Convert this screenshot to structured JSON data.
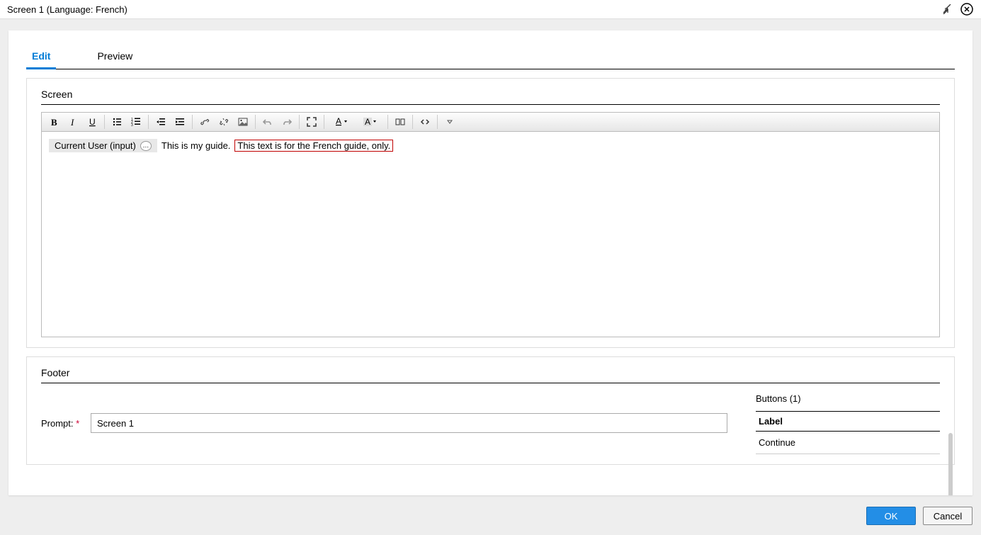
{
  "window": {
    "title": "Screen 1 (Language: French)"
  },
  "tabs": {
    "edit": "Edit",
    "preview": "Preview"
  },
  "screen": {
    "section_label": "Screen",
    "token_text": "Current User (input)",
    "plain_text_1": "This is my guide.",
    "highlighted_text": "This text is for the French guide, only."
  },
  "footer": {
    "section_label": "Footer",
    "prompt_label": "Prompt:",
    "prompt_value": "Screen 1",
    "buttons_title": "Buttons (1)",
    "table_header": "Label",
    "table_row_1": "Continue"
  },
  "actions": {
    "ok": "OK",
    "cancel": "Cancel"
  }
}
